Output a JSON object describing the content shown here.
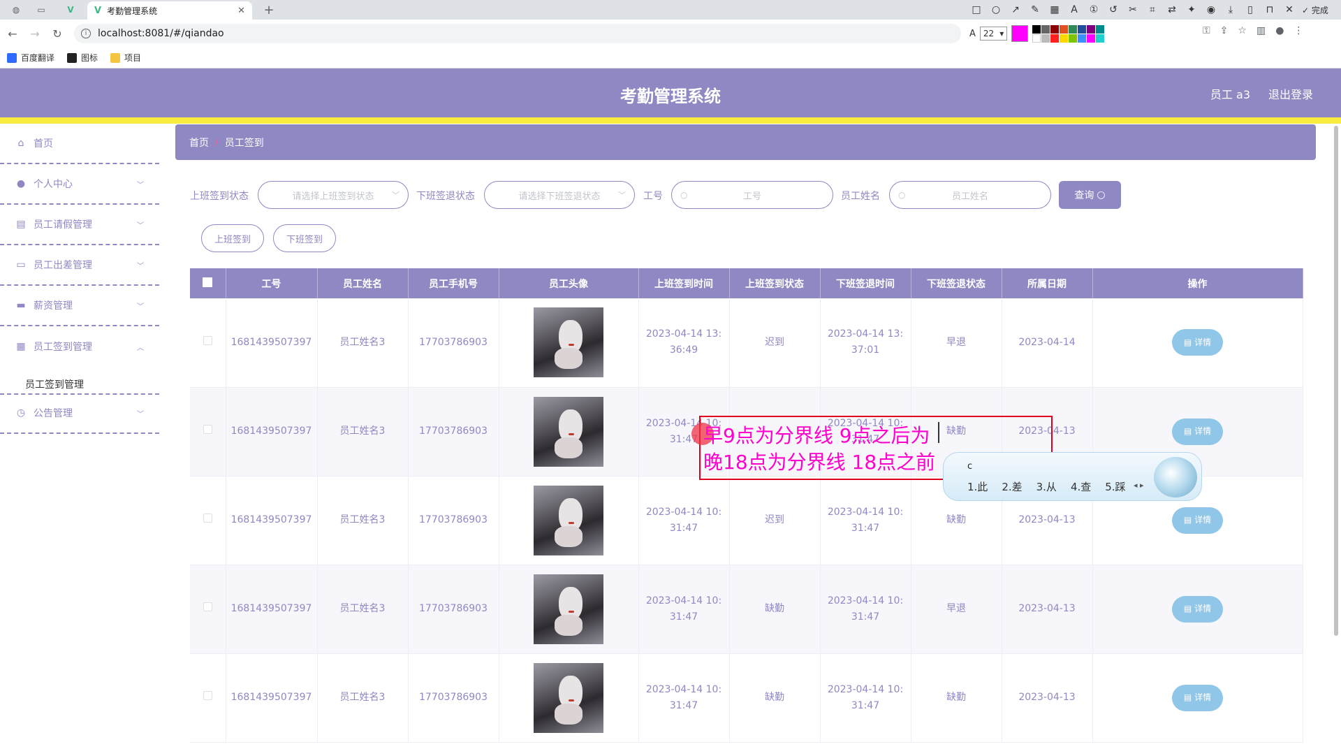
{
  "browser": {
    "tab_title": "考勤管理系统",
    "url": "localhost:8081/#/qiandao",
    "toolbar_done": "完成",
    "font_size": "22",
    "bookmarks": [
      "百度翻译",
      "图标",
      "项目"
    ]
  },
  "header": {
    "title": "考勤管理系统",
    "user": "员工 a3",
    "logout": "退出登录"
  },
  "sidebar": {
    "items": [
      {
        "label": "首页",
        "icon": "home-icon"
      },
      {
        "label": "个人中心",
        "icon": "user-icon"
      },
      {
        "label": "员工请假管理",
        "icon": "chart-icon"
      },
      {
        "label": "员工出差管理",
        "icon": "message-icon"
      },
      {
        "label": "薪资管理",
        "icon": "monitor-icon"
      },
      {
        "label": "员工签到管理",
        "icon": "grid-icon"
      },
      {
        "label": "公告管理",
        "icon": "clock-icon"
      }
    ],
    "sub_item": "员工签到管理"
  },
  "breadcrumb": {
    "home": "首页",
    "sep": "/",
    "current": "员工签到"
  },
  "search": {
    "checkin_status_label": "上班签到状态",
    "checkin_status_placeholder": "请选择上班签到状态",
    "checkout_status_label": "下班签退状态",
    "checkout_status_placeholder": "请选择下班签退状态",
    "emp_no_label": "工号",
    "emp_no_placeholder": "工号",
    "emp_name_label": "员工姓名",
    "emp_name_placeholder": "员工姓名",
    "query_button": "查询"
  },
  "actions": {
    "checkin": "上班签到",
    "checkout": "下班签到"
  },
  "table": {
    "headers": [
      "工号",
      "员工姓名",
      "员工手机号",
      "员工头像",
      "上班签到时间",
      "上班签到状态",
      "下班签退时间",
      "下班签退状态",
      "所属日期",
      "操作"
    ],
    "detail_label": "详情",
    "rows": [
      {
        "emp_no": "1681439507397",
        "name": "员工姓名3",
        "phone": "17703786903",
        "checkin_time_1": "2023-04-14 13:",
        "checkin_time_2": "36:49",
        "checkin_status": "迟到",
        "checkout_time_1": "2023-04-14 13:",
        "checkout_time_2": "37:01",
        "checkout_status": "早退",
        "date": "2023-04-14"
      },
      {
        "emp_no": "1681439507397",
        "name": "员工姓名3",
        "phone": "17703786903",
        "checkin_time_1": "2023-04-14 10:",
        "checkin_time_2": "31:47",
        "checkin_status": "",
        "checkout_time_1": "2023-04-14 10:",
        "checkout_time_2": "31:47",
        "checkout_status": "缺勤",
        "date": "2023-04-13"
      },
      {
        "emp_no": "1681439507397",
        "name": "员工姓名3",
        "phone": "17703786903",
        "checkin_time_1": "2023-04-14 10:",
        "checkin_time_2": "31:47",
        "checkin_status": "迟到",
        "checkout_time_1": "2023-04-14 10:",
        "checkout_time_2": "31:47",
        "checkout_status": "缺勤",
        "date": "2023-04-13"
      },
      {
        "emp_no": "1681439507397",
        "name": "员工姓名3",
        "phone": "17703786903",
        "checkin_time_1": "2023-04-14 10:",
        "checkin_time_2": "31:47",
        "checkin_status": "缺勤",
        "checkout_time_1": "2023-04-14 10:",
        "checkout_time_2": "31:47",
        "checkout_status": "早退",
        "date": "2023-04-13"
      },
      {
        "emp_no": "1681439507397",
        "name": "员工姓名3",
        "phone": "17703786903",
        "checkin_time_1": "2023-04-14 10:",
        "checkin_time_2": "31:47",
        "checkin_status": "缺勤",
        "checkout_time_1": "2023-04-14 10:",
        "checkout_time_2": "31:47",
        "checkout_status": "缺勤",
        "date": "2023-04-13"
      }
    ]
  },
  "annotation": {
    "line1": "早9点为分界线 9点之后为",
    "line2": "晚18点为分界线   18点之前",
    "color": "#ff00cc"
  },
  "ime": {
    "input": "c",
    "candidates": [
      "1.此",
      "2.差",
      "3.从",
      "4.查",
      "5.踩"
    ]
  },
  "colors": {
    "primary": "#8e88c3",
    "accent": "#f8ec3e",
    "detail": "#90c6e8"
  }
}
